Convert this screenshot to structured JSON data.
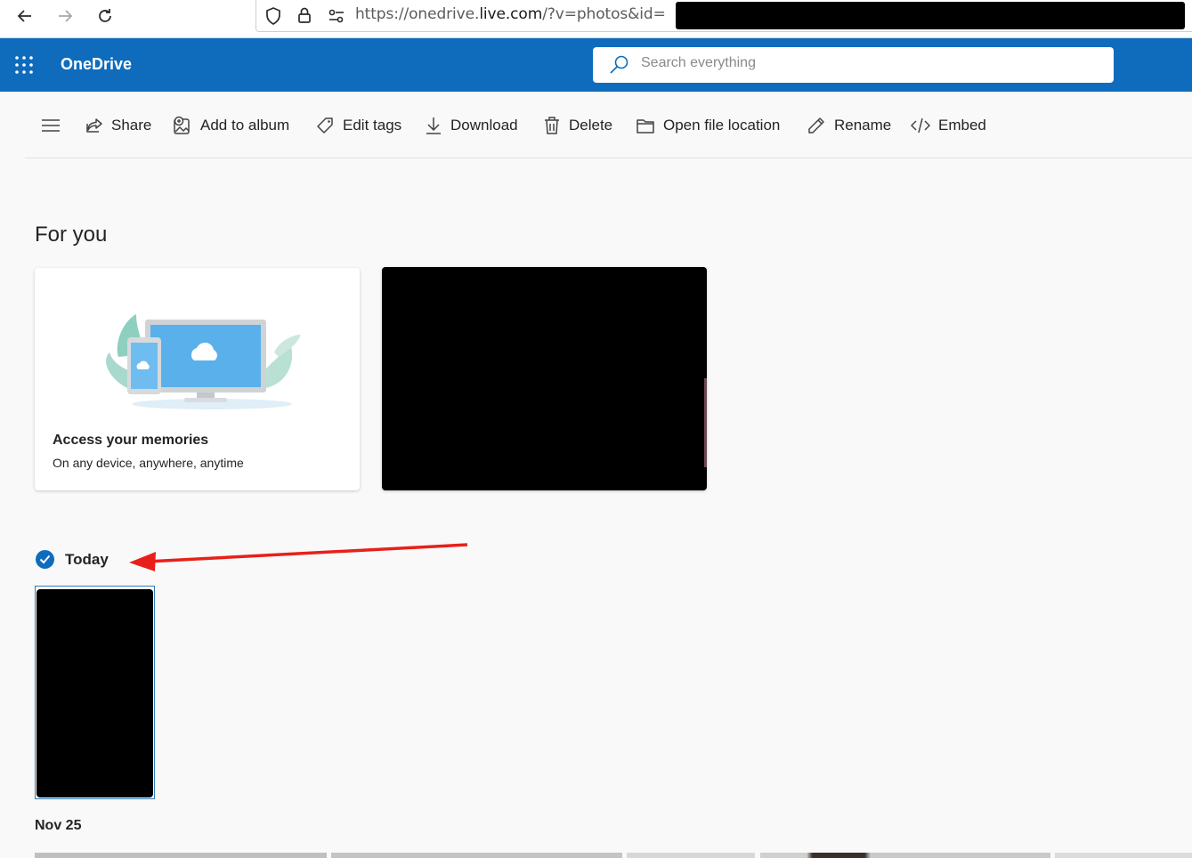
{
  "browser": {
    "url_prefix": "https://onedrive.",
    "url_host": "live.com",
    "url_path": "/?v=photos&id="
  },
  "app": {
    "title": "OneDrive",
    "brand_color": "#0f6cbd"
  },
  "search": {
    "placeholder": "Search everything"
  },
  "toolbar": {
    "share": "Share",
    "add_to_album": "Add to album",
    "edit_tags": "Edit tags",
    "download": "Download",
    "delete": "Delete",
    "open_file_location": "Open file location",
    "rename": "Rename",
    "embed": "Embed"
  },
  "for_you": {
    "heading": "For you",
    "memories_card": {
      "title": "Access your memories",
      "subtitle": "On any device, anywhere, anytime"
    }
  },
  "groups": {
    "today": "Today",
    "nov25": "Nov 25"
  },
  "annotation": {
    "arrow_color": "#e8201a"
  }
}
